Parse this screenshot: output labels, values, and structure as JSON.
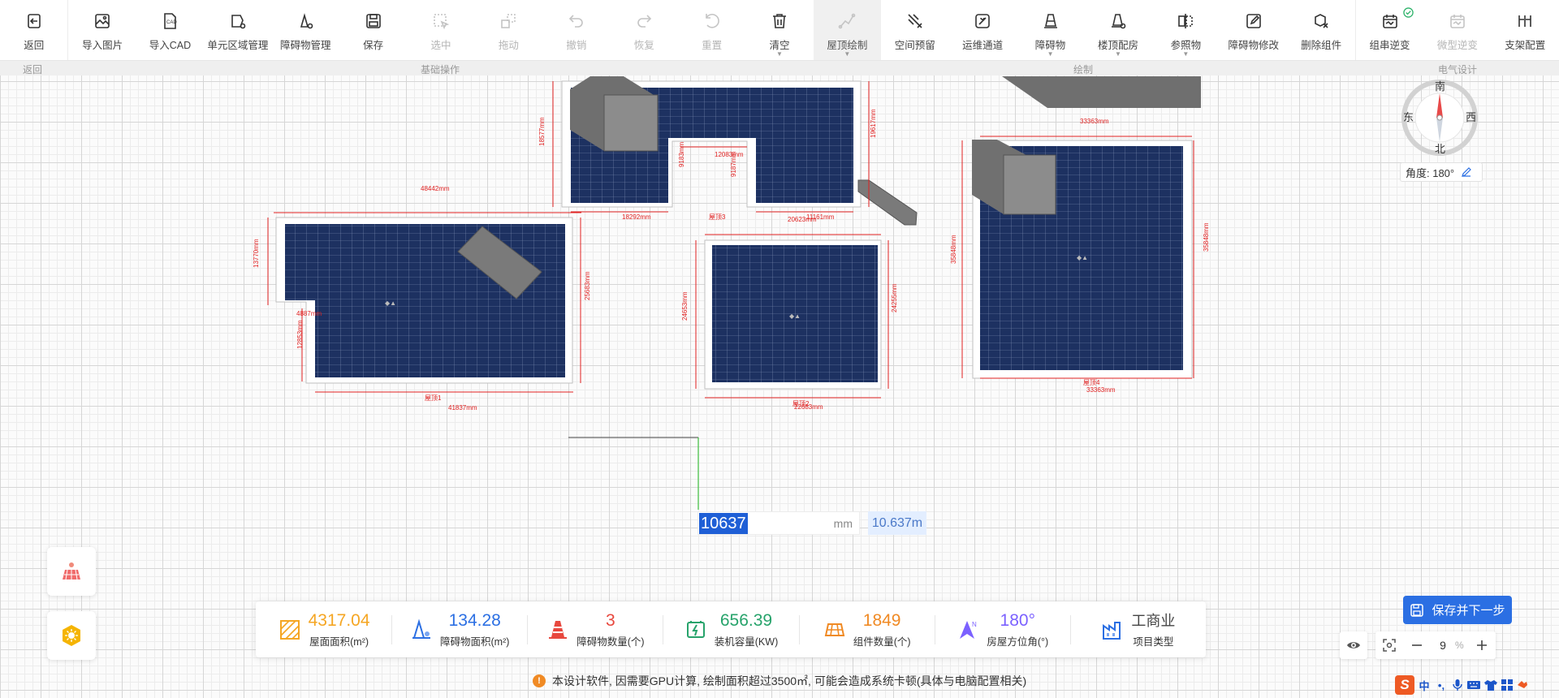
{
  "toolbar": {
    "items": [
      {
        "label": "返回",
        "icon": "back-icon"
      },
      {
        "label": "导入图片",
        "icon": "import-image-icon"
      },
      {
        "label": "导入CAD",
        "icon": "import-cad-icon"
      },
      {
        "label": "单元区域管理",
        "icon": "unit-area-icon"
      },
      {
        "label": "障碍物管理",
        "icon": "obstacle-manage-icon"
      },
      {
        "label": "保存",
        "icon": "save-icon"
      },
      {
        "label": "选中",
        "icon": "select-icon"
      },
      {
        "label": "拖动",
        "icon": "drag-icon"
      },
      {
        "label": "撤销",
        "icon": "undo-icon"
      },
      {
        "label": "恢复",
        "icon": "redo-icon"
      },
      {
        "label": "重置",
        "icon": "reset-icon"
      },
      {
        "label": "清空",
        "icon": "trash-icon"
      },
      {
        "label": "屋顶绘制",
        "icon": "roof-draw-icon"
      },
      {
        "label": "空间预留",
        "icon": "space-reserve-icon"
      },
      {
        "label": "运维通道",
        "icon": "maintenance-channel-icon"
      },
      {
        "label": "障碍物",
        "icon": "obstacle-icon"
      },
      {
        "label": "楼顶配房",
        "icon": "rooftop-room-icon"
      },
      {
        "label": "参照物",
        "icon": "reference-icon"
      },
      {
        "label": "障碍物修改",
        "icon": "obstacle-edit-icon"
      },
      {
        "label": "删除组件",
        "icon": "delete-component-icon"
      },
      {
        "label": "组串逆变",
        "icon": "string-inverter-icon"
      },
      {
        "label": "微型逆变",
        "icon": "micro-inverter-icon"
      },
      {
        "label": "支架配置",
        "icon": "bracket-config-icon"
      }
    ],
    "groups": {
      "back": "返回",
      "basic": "基础操作",
      "draw": "绘制",
      "electrical": "电气设计"
    }
  },
  "compass": {
    "north": "北",
    "south": "南",
    "east": "东",
    "west": "西",
    "angle_label": "角度: 180°"
  },
  "dimensions": {
    "roof1": [
      "48442mm",
      "13770mm",
      "25683mm",
      "4887mm",
      "12853mm",
      "41837mm",
      "屋顶1"
    ],
    "roof2": [
      "18577mm",
      "19617mm",
      "18292mm",
      "12083mm",
      "9183mm",
      "9187mm",
      "11161mm",
      "20623mm"
    ],
    "roof3": [
      "屋顶3",
      "24653mm",
      "24255mm",
      "屋顶2",
      "22683mm"
    ],
    "roof4": [
      "33363mm",
      "35848mm",
      "35848mm",
      "屋顶4",
      "33363mm"
    ]
  },
  "length_input": {
    "value": "10637",
    "unit": "mm",
    "meters": "10.637m"
  },
  "stats": [
    {
      "value": "4317.04",
      "label": "屋面面积",
      "unit": "(m²)",
      "color": "#f5a623"
    },
    {
      "value": "134.28",
      "label": "障碍物面积",
      "unit": "(m²)",
      "color": "#2b6fe3"
    },
    {
      "value": "3",
      "label": "障碍物数量(个)",
      "unit": "",
      "color": "#e8483e"
    },
    {
      "value": "656.39",
      "label": "装机容量",
      "unit": "(KW)",
      "color": "#27a36b"
    },
    {
      "value": "1849",
      "label": "组件数量(个)",
      "unit": "",
      "color": "#f08a24"
    },
    {
      "value": "180°",
      "label": "房屋方位角(°)",
      "unit": "",
      "color": "#7b61ff"
    },
    {
      "value": "工商业",
      "label": "项目类型",
      "unit": "",
      "color": "#444444"
    }
  ],
  "save_next": "保存并下一步",
  "zoom": {
    "value": "9",
    "pct": "%"
  },
  "notice": "本设计软件, 因需要GPU计算, 绘制面积超过3500㎡, 可能会造成系统卡顿(具体与电脑配置相关)",
  "ime": {
    "logo": "S",
    "lang": "中"
  }
}
